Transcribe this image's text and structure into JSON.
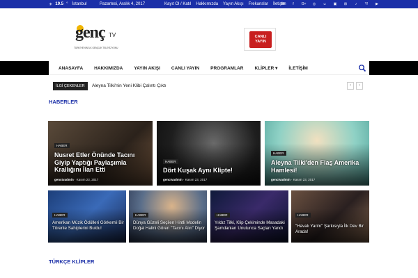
{
  "topbar": {
    "temp": "19.5",
    "unit": "°",
    "city": "İstanbul",
    "date": "Pazartesi, Aralık 4, 2017",
    "links": [
      "Kayıt Ol / Katıl",
      "Hakkımızda",
      "Yayın Akışı",
      "Frekanslar",
      "İletişim"
    ],
    "social": [
      "Bē",
      "f",
      "G+",
      "◎",
      "☺",
      "▣",
      "⊞",
      "♪",
      "Y!",
      "▶"
    ]
  },
  "logo": {
    "text": "genç",
    "tv": "TV",
    "sub": "TÜRKİYE'NİN İLK GENÇLİK TELEVİZYONU"
  },
  "live": {
    "text": "CANLI YAYIN"
  },
  "nav": {
    "items": [
      "ANASAYFA",
      "HAKKIMIZDA",
      "YAYIN AKIŞI",
      "CANLI YAYIN",
      "PROGRAMLAR",
      "KLİPLER",
      "İLETİŞİM"
    ]
  },
  "ticker": {
    "tag": "İLGİ ÇEKENLER",
    "headline": "Aleyna Tilki'nin Yeni Klibi Çalıntı Çıktı"
  },
  "sections": {
    "news": "HABERLER",
    "clips": "TÜRKÇE KLİPLER"
  },
  "big_cards": [
    {
      "cat": "HABER",
      "title": "Nusret Etler Önünde Tacını Giyip Yaptığı Paylaşımla Krallığını İlan Etti",
      "author": "genctvadmin",
      "date": "Kasım 23, 2017"
    },
    {
      "cat": "HABER",
      "title": "Dört Kuşak Aynı Klipte!",
      "author": "genctvadmin",
      "date": "Kasım 23, 2017"
    },
    {
      "cat": "HABER",
      "title": "Aleyna Tilki'den Flaş Amerika Hamlesi!",
      "author": "genctvadmin",
      "date": "Kasım 23, 2017"
    }
  ],
  "small_cards": [
    {
      "cat": "HABER",
      "title": "Amerikan Müzik Ödülleri Görkemli Bir Törenle Sahiplerini Buldu!"
    },
    {
      "cat": "HABER",
      "title": "Dünya Güzeli Seçilen Hintli Modelin Doğal Halini Gören \"Tacını Alın\" Diyor"
    },
    {
      "cat": "HABER",
      "title": "Yıldız Tilki, Klip Çekiminde Masadaki Şamdanları Unutunca Saçları Yandı"
    },
    {
      "cat": "HABER",
      "title": "\"Havalı Yarim\" Şarkısıyla İlk Dev Bir Arada!"
    }
  ]
}
